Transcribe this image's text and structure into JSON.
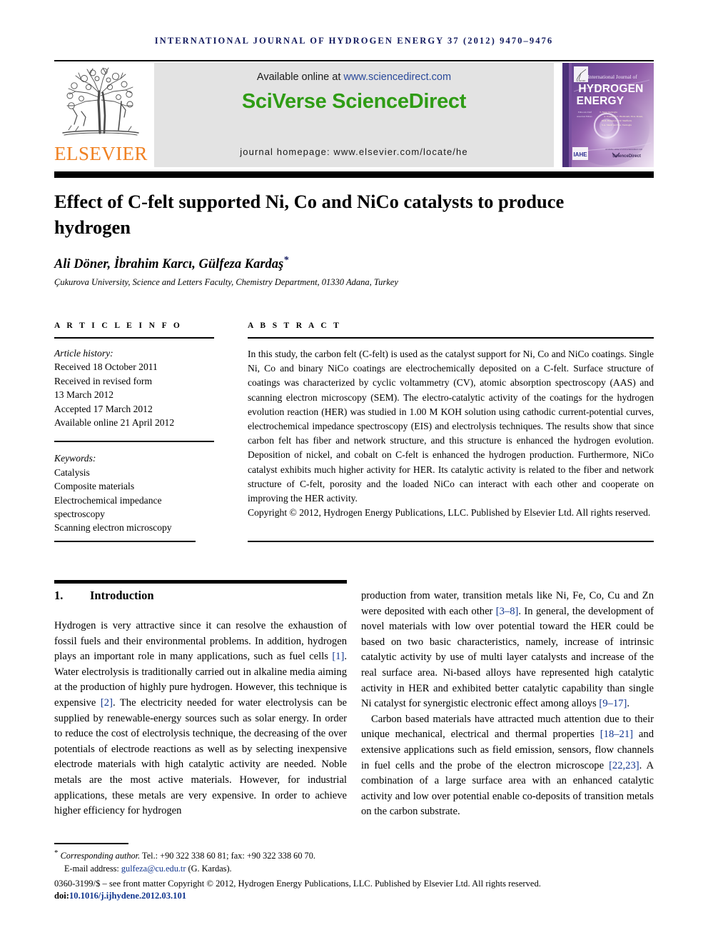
{
  "running_head": "INTERNATIONAL JOURNAL OF HYDROGEN ENERGY 37 (2012) 9470–9476",
  "header": {
    "elsevier_wordmark": "ELSEVIER",
    "available_prefix": "Available online at ",
    "available_url": "www.sciencedirect.com",
    "sciverse_logo": "SciVerse ScienceDirect",
    "homepage": "journal homepage: www.elsevier.com/locate/he",
    "cover": {
      "publisher": "ELSEVIER",
      "line1": "International Journal of",
      "line2": "HYDROGEN",
      "line3": "ENERGY",
      "editor_label": "Editor-in-Chief",
      "editors_label": "Associate Editors",
      "editor_names": "T. Nejat Veziroglu",
      "editors_names": "A. Kudriz, E.C. Bienbaum, M.A. Rosen,\nM.D. Hampton, J.W. Sheffield,\nS.A. Sherif and E.A. Veziroglu",
      "footer_logo": "IAHE",
      "footer_note": "Available online at www.sciencedirect.com",
      "footer_brand": "ScienceDirect"
    }
  },
  "article": {
    "title": "Effect of C-felt supported Ni, Co and NiCo catalysts to produce hydrogen",
    "authors": "Ali Döner, İbrahim Karcı, Gülfeza Kardaş",
    "author_star": "*",
    "affiliation": "Çukurova University, Science and Letters Faculty, Chemistry Department, 01330 Adana, Turkey"
  },
  "info": {
    "heading": "A R T I C L E   I N F O",
    "history_label": "Article history:",
    "history": [
      "Received 18 October 2011",
      "Received in revised form",
      "13 March 2012",
      "Accepted 17 March 2012",
      "Available online 21 April 2012"
    ],
    "keywords_label": "Keywords:",
    "keywords": [
      "Catalysis",
      "Composite materials",
      "Electrochemical impedance",
      "spectroscopy",
      "Scanning electron microscopy"
    ]
  },
  "abstract": {
    "heading": "A B S T R A C T",
    "text": "In this study, the carbon felt (C-felt) is used as the catalyst support for Ni, Co and NiCo coatings. Single Ni, Co and binary NiCo coatings are electrochemically deposited on a C-felt. Surface structure of coatings was characterized by cyclic voltammetry (CV), atomic absorption spectroscopy (AAS) and scanning electron microscopy (SEM). The electro-catalytic activity of the coatings for the hydrogen evolution reaction (HER) was studied in 1.00 M KOH solution using cathodic current-potential curves, electrochemical impedance spectroscopy (EIS) and electrolysis techniques. The results show that since carbon felt has fiber and network structure, and this structure is enhanced the hydrogen evolution. Deposition of nickel, and cobalt on C-felt is enhanced the hydrogen production. Furthermore, NiCo catalyst exhibits much higher activity for HER. Its catalytic activity is related to the fiber and network structure of C-felt, porosity and the loaded NiCo can interact with each other and cooperate on improving the HER activity.",
    "copyright": "Copyright © 2012, Hydrogen Energy Publications, LLC. Published by Elsevier Ltd. All rights reserved."
  },
  "introduction": {
    "number": "1.",
    "title": "Introduction",
    "left_para_1_a": "Hydrogen is very attractive since it can resolve the exhaustion of fossil fuels and their environmental problems. In addition, hydrogen plays an important role in many applications, such as fuel cells ",
    "left_cite_1": "[1]",
    "left_para_1_b": ". Water electrolysis is traditionally carried out in alkaline media aiming at the production of highly pure hydrogen. However, this technique is expensive ",
    "left_cite_2": "[2]",
    "left_para_1_c": ". The electricity needed for water electrolysis can be supplied by renewable-energy sources such as solar energy. In order to reduce the cost of electrolysis technique, the decreasing of the over potentials of electrode reactions as well as by selecting inexpensive electrode materials with high catalytic activity are needed. Noble metals are the most active materials. However, for industrial applications, these metals are very expensive. In order to achieve higher efficiency for hydrogen",
    "right_para_1_a": "production from water, transition metals like Ni, Fe, Co, Cu and Zn were deposited with each other ",
    "right_cite_1": "[3–8]",
    "right_para_1_b": ". In general, the development of novel materials with low over potential toward the HER could be based on two basic characteristics, namely, increase of intrinsic catalytic activity by use of multi layer catalysts and increase of the real surface area. Ni-based alloys have represented high catalytic activity in HER and exhibited better catalytic capability than single Ni catalyst for synergistic electronic effect among alloys ",
    "right_cite_2": "[9–17]",
    "right_para_1_c": ".",
    "right_para_2_a": "Carbon based materials have attracted much attention due to their unique mechanical, electrical and thermal properties ",
    "right_cite_3": "[18–21]",
    "right_para_2_b": " and extensive applications such as field emission, sensors, flow channels in fuel cells and the probe of the electron microscope ",
    "right_cite_4": "[22,23]",
    "right_para_2_c": ". A combination of a large surface area with an enhanced catalytic activity and low over potential enable co-deposits of transition metals on the carbon substrate."
  },
  "footer": {
    "corresponding_star": "*",
    "corresponding_label": "Corresponding author.",
    "corresponding_contact": " Tel.: +90 322 338 60 81; fax: +90 322 338 60 70.",
    "email_label": "E-mail address: ",
    "email": "gulfeza@cu.edu.tr",
    "email_suffix": " (G. Kardas).",
    "issn_line": "0360-3199/$ – see front matter Copyright © 2012, Hydrogen Energy Publications, LLC. Published by Elsevier Ltd. All rights reserved.",
    "doi_label": "doi:",
    "doi_value": "10.1016/j.ijhydene.2012.03.101"
  },
  "colors": {
    "running_head": "#11195e",
    "elsevier_orange": "#f08122",
    "sciencedirect_green": "#2f9c15",
    "link_blue": "#2b4a9b",
    "citation_blue": "#11358e"
  }
}
